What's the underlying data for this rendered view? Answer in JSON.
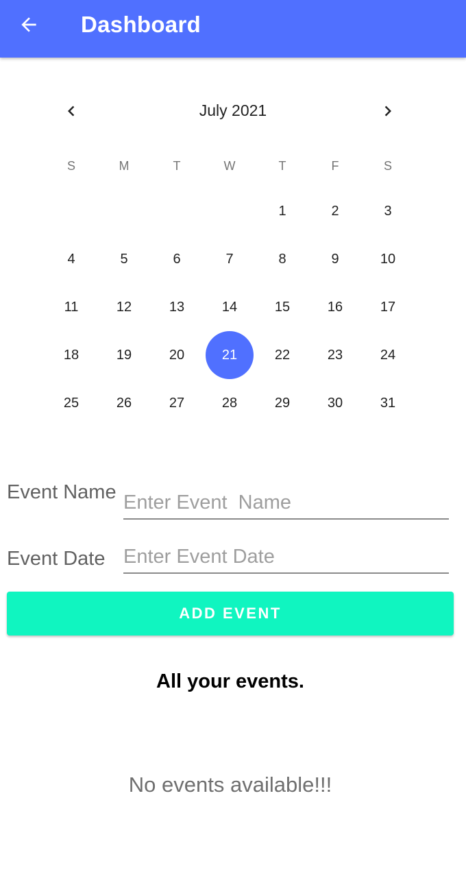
{
  "app_bar": {
    "title": "Dashboard",
    "back_icon": "arrow-left-icon",
    "color": "#5070ff"
  },
  "calendar": {
    "month_label": "July 2021",
    "prev_icon": "chevron-left-icon",
    "next_icon": "chevron-right-icon",
    "weekdays": [
      "S",
      "M",
      "T",
      "W",
      "T",
      "F",
      "S"
    ],
    "first_weekday_index": 4,
    "days_in_month": 31,
    "selected_day": 21,
    "selected_color": "#5070ff"
  },
  "form": {
    "event_name_label": "Event Name",
    "event_name_placeholder": "Enter Event  Name",
    "event_name_value": "",
    "event_date_label": "Event Date",
    "event_date_placeholder": "Enter Event Date",
    "event_date_value": "",
    "add_button_label": "ADD EVENT",
    "add_button_color": "#10f5c0"
  },
  "events": {
    "section_title": "All your events.",
    "empty_message": "No events available!!!",
    "items": []
  }
}
